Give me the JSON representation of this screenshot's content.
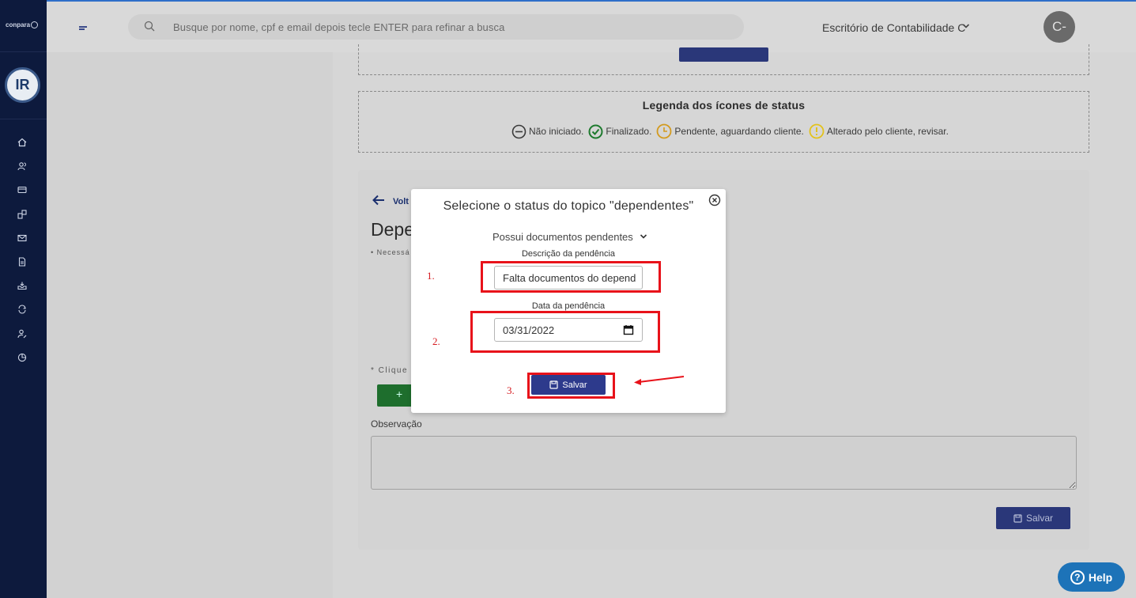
{
  "header": {
    "search_placeholder": "Busque por nome, cpf e email depois tecle ENTER para refinar a busca",
    "office": "Escritório de Contabilidade C",
    "avatar_initials": "C-"
  },
  "sidebar": {
    "brand": "conpara",
    "logo_text": "IR",
    "items": [
      "home-icon",
      "users-icon",
      "card-icon",
      "dashboard-icon",
      "mail-icon",
      "document-icon",
      "inbox-icon",
      "sync-icon",
      "user-edit-icon",
      "chart-pie-icon"
    ]
  },
  "legend": {
    "title": "Legenda dos ícones de status",
    "items": [
      {
        "icon": "minus-circle-icon",
        "label": "Não iniciado.",
        "color": "#3a3a3a"
      },
      {
        "icon": "check-circle-icon",
        "label": "Finalizado.",
        "color": "#1e7a2e"
      },
      {
        "icon": "clock-icon",
        "label": "Pendente, aguardando cliente.",
        "color": "#d39a1e"
      },
      {
        "icon": "alert-circle-icon",
        "label": "Alterado pelo cliente, revisar.",
        "color": "#e3c21b"
      }
    ]
  },
  "page": {
    "back_label": "Volt",
    "heading": "Depe",
    "small_note": "• Necessá",
    "click_note": "* Clique e",
    "add_label": "+",
    "observation_label": "Observação",
    "save_label": "Salvar"
  },
  "modal": {
    "title": "Selecione o status do topico \"dependentes\"",
    "status_value": "Possui documentos pendentes",
    "desc_label": "Descrição da pendência",
    "desc_value": "Falta documentos do depend",
    "date_label": "Data da pendência",
    "date_value": "03/31/2022",
    "save_label": "Salvar"
  },
  "annotations": {
    "n1": "1.",
    "n2": "2.",
    "n3": "3.",
    "color": "#e8121a"
  },
  "help": {
    "label": "Help",
    "q": "?"
  }
}
